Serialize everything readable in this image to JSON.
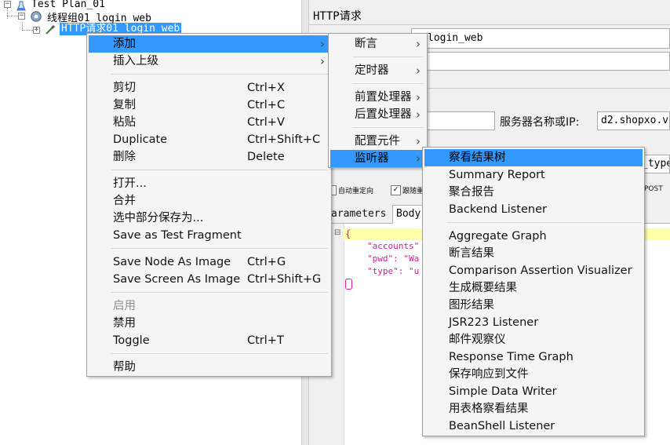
{
  "tree": {
    "plan": "Test Plan_01",
    "thread_group": "线程组01_login_web",
    "sampler": "HTTP请求01_login_web"
  },
  "editor": {
    "title": "HTTP请求",
    "name_value": "login_web",
    "server_label": "服务器名称或IP:",
    "server_value": "d2.shopxo.v",
    "field_suffix": "_type",
    "auto_redirect": "自动重定向",
    "follow_redirect": "跟随重",
    "method_fragment": "POST",
    "tabs": {
      "params": "arameters",
      "body": "Body"
    },
    "body_lines": [
      "{",
      "\"accounts\"",
      "\"pwd\": \"Wa",
      "\"type\": \"u"
    ],
    "line_marker": "⊟"
  },
  "context_menu": {
    "groups": [
      [
        {
          "label": "添加",
          "shortcut": "",
          "submenu": true,
          "highlighted": true
        },
        {
          "label": "插入上级",
          "shortcut": "",
          "submenu": true
        }
      ],
      [
        {
          "label": "剪切",
          "shortcut": "Ctrl+X"
        },
        {
          "label": "复制",
          "shortcut": "Ctrl+C"
        },
        {
          "label": "粘贴",
          "shortcut": "Ctrl+V"
        },
        {
          "label": "Duplicate",
          "shortcut": "Ctrl+Shift+C"
        },
        {
          "label": "删除",
          "shortcut": "Delete"
        }
      ],
      [
        {
          "label": "打开...",
          "shortcut": ""
        },
        {
          "label": "合并",
          "shortcut": ""
        },
        {
          "label": "选中部分保存为...",
          "shortcut": ""
        },
        {
          "label": "Save as Test Fragment",
          "shortcut": ""
        }
      ],
      [
        {
          "label": "Save Node As Image",
          "shortcut": "Ctrl+G"
        },
        {
          "label": "Save Screen As Image",
          "shortcut": "Ctrl+Shift+G"
        }
      ],
      [
        {
          "label": "启用",
          "shortcut": "",
          "disabled": true
        },
        {
          "label": "禁用",
          "shortcut": ""
        },
        {
          "label": "Toggle",
          "shortcut": "Ctrl+T"
        }
      ],
      [
        {
          "label": "帮助",
          "shortcut": ""
        }
      ]
    ]
  },
  "add_submenu": {
    "groups": [
      [
        {
          "label": "断言",
          "submenu": true
        }
      ],
      [
        {
          "label": "定时器",
          "submenu": true
        }
      ],
      [
        {
          "label": "前置处理器",
          "submenu": true
        },
        {
          "label": "后置处理器",
          "submenu": true
        }
      ],
      [
        {
          "label": "配置元件",
          "submenu": true
        },
        {
          "label": "监听器",
          "submenu": true,
          "highlighted": true
        }
      ]
    ]
  },
  "listener_submenu": {
    "groups": [
      [
        {
          "label": "察看结果树",
          "highlighted": true
        },
        {
          "label": "Summary Report"
        },
        {
          "label": "聚合报告"
        },
        {
          "label": "Backend Listener"
        }
      ],
      [
        {
          "label": "Aggregate Graph"
        },
        {
          "label": "断言结果"
        },
        {
          "label": "Comparison Assertion Visualizer"
        },
        {
          "label": "生成概要结果"
        },
        {
          "label": "图形结果"
        },
        {
          "label": "JSR223 Listener"
        },
        {
          "label": "邮件观察仪"
        },
        {
          "label": "Response Time Graph"
        },
        {
          "label": "保存响应到文件"
        },
        {
          "label": "Simple Data Writer"
        },
        {
          "label": "用表格察看结果"
        },
        {
          "label": "BeanShell Listener"
        }
      ]
    ]
  },
  "colors": {
    "highlight": "#3399ff",
    "menu_bg": "#f5f5f5",
    "json_text": "#d21e9b"
  }
}
